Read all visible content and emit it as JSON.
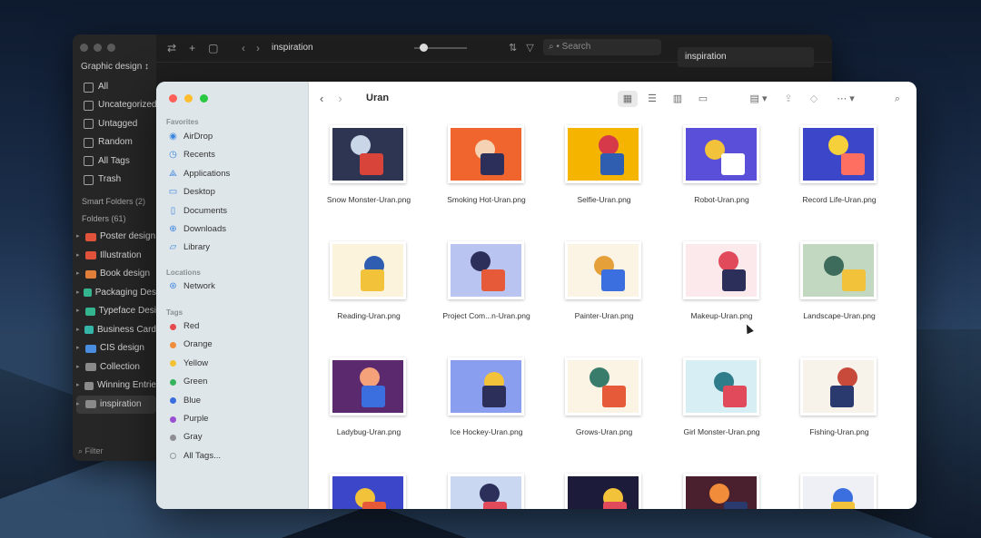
{
  "back_app": {
    "library_label": "Graphic design ↕",
    "title": "inspiration",
    "search_placeholder": "⌕ • Search",
    "right_panel_title": "inspiration",
    "nav_items": [
      {
        "label": "All",
        "icon": "grid-icon"
      },
      {
        "label": "Uncategorized",
        "icon": "doc-icon"
      },
      {
        "label": "Untagged",
        "icon": "tag-icon"
      },
      {
        "label": "Random",
        "icon": "shuffle-icon"
      },
      {
        "label": "All Tags",
        "icon": "tags-icon"
      },
      {
        "label": "Trash",
        "icon": "trash-icon"
      }
    ],
    "smart_folders_label": "Smart Folders (2)",
    "folders_label": "Folders (61)",
    "folders": [
      {
        "label": "Poster design",
        "color": "#e0533a"
      },
      {
        "label": "Illustration",
        "color": "#e0533a"
      },
      {
        "label": "Book design",
        "color": "#e07e3a"
      },
      {
        "label": "Packaging Des",
        "color": "#35b58f"
      },
      {
        "label": "Typeface Desi",
        "color": "#35b58f"
      },
      {
        "label": "Business Card",
        "color": "#35b5a8"
      },
      {
        "label": "CIS design",
        "color": "#4a8ce0"
      },
      {
        "label": "Collection",
        "color": "#8a8a8a"
      },
      {
        "label": "Winning Entrie",
        "color": "#8a8a8a"
      },
      {
        "label": "inspiration",
        "color": "#8a8a8a",
        "selected": true
      }
    ],
    "filter_placeholder": "Filter"
  },
  "finder": {
    "current_folder": "Uran",
    "sections": {
      "favorites": "Favorites",
      "locations": "Locations",
      "tags": "Tags"
    },
    "favorites": [
      {
        "label": "AirDrop",
        "icon": "airdrop-icon"
      },
      {
        "label": "Recents",
        "icon": "clock-icon"
      },
      {
        "label": "Applications",
        "icon": "applications-icon"
      },
      {
        "label": "Desktop",
        "icon": "desktop-icon"
      },
      {
        "label": "Documents",
        "icon": "documents-icon"
      },
      {
        "label": "Downloads",
        "icon": "downloads-icon"
      },
      {
        "label": "Library",
        "icon": "folder-icon"
      }
    ],
    "locations": [
      {
        "label": "Network",
        "icon": "network-icon"
      }
    ],
    "tags": [
      {
        "label": "Red",
        "color": "#e5484d"
      },
      {
        "label": "Orange",
        "color": "#f08c3a"
      },
      {
        "label": "Yellow",
        "color": "#f2c230"
      },
      {
        "label": "Green",
        "color": "#36b45b"
      },
      {
        "label": "Blue",
        "color": "#3b6fe0"
      },
      {
        "label": "Purple",
        "color": "#9a4fd0"
      },
      {
        "label": "Gray",
        "color": "#8e8e93"
      },
      {
        "label": "All Tags...",
        "color": ""
      }
    ],
    "files": [
      {
        "name": "Snow Monster-Uran.png",
        "bg": "#2e3552",
        "a": "#c9d6e8",
        "b": "#d8433a"
      },
      {
        "name": "Smoking Hot-Uran.png",
        "bg": "#f0642e",
        "a": "#f5d2b3",
        "b": "#2b2f5a"
      },
      {
        "name": "Selfie-Uran.png",
        "bg": "#f5b400",
        "a": "#d63a4a",
        "b": "#2f5db0"
      },
      {
        "name": "Robot-Uran.png",
        "bg": "#5a4fd8",
        "a": "#f2c23a",
        "b": "#ffffff"
      },
      {
        "name": "Record Life-Uran.png",
        "bg": "#3b46c8",
        "a": "#f5d03a",
        "b": "#ff6f61"
      },
      {
        "name": "Reading-Uran.png",
        "bg": "#fbf3dc",
        "a": "#2f5db0",
        "b": "#f2c23a"
      },
      {
        "name": "Project Com...n-Uran.png",
        "bg": "#b9c4f0",
        "a": "#2b2f5a",
        "b": "#e65a3a"
      },
      {
        "name": "Painter-Uran.png",
        "bg": "#fbf3e3",
        "a": "#e5a03a",
        "b": "#3b6fe0"
      },
      {
        "name": "Makeup-Uran.png",
        "bg": "#fbe9ec",
        "a": "#e04a5a",
        "b": "#2b2f5a"
      },
      {
        "name": "Landscape-Uran.png",
        "bg": "#c3d8c0",
        "a": "#3d6b5c",
        "b": "#f2c23a"
      },
      {
        "name": "Ladybug-Uran.png",
        "bg": "#5b2a6e",
        "a": "#f5a27a",
        "b": "#3b6fe0"
      },
      {
        "name": "Ice Hockey-Uran.png",
        "bg": "#8a9ef0",
        "a": "#f2c23a",
        "b": "#2b2f5a"
      },
      {
        "name": "Grows-Uran.png",
        "bg": "#fbf3e3",
        "a": "#3a7c6b",
        "b": "#e65a3a"
      },
      {
        "name": "Girl Monster-Uran.png",
        "bg": "#d8eef5",
        "a": "#2f7c8a",
        "b": "#e04a5a"
      },
      {
        "name": "Fishing-Uran.png",
        "bg": "#f7f2ea",
        "a": "#c84a3a",
        "b": "#2b3a6e"
      },
      {
        "name": "",
        "bg": "#3b46c8",
        "a": "#f2c23a",
        "b": "#e65a3a"
      },
      {
        "name": "",
        "bg": "#c9d8f0",
        "a": "#2b2f5a",
        "b": "#e04a5a"
      },
      {
        "name": "",
        "bg": "#1c1c3a",
        "a": "#f2c23a",
        "b": "#e04a5a"
      },
      {
        "name": "",
        "bg": "#4a1f2e",
        "a": "#f08c3a",
        "b": "#2b3a6e"
      },
      {
        "name": "",
        "bg": "#eef0f5",
        "a": "#3b6fe0",
        "b": "#f2c23a"
      }
    ]
  }
}
